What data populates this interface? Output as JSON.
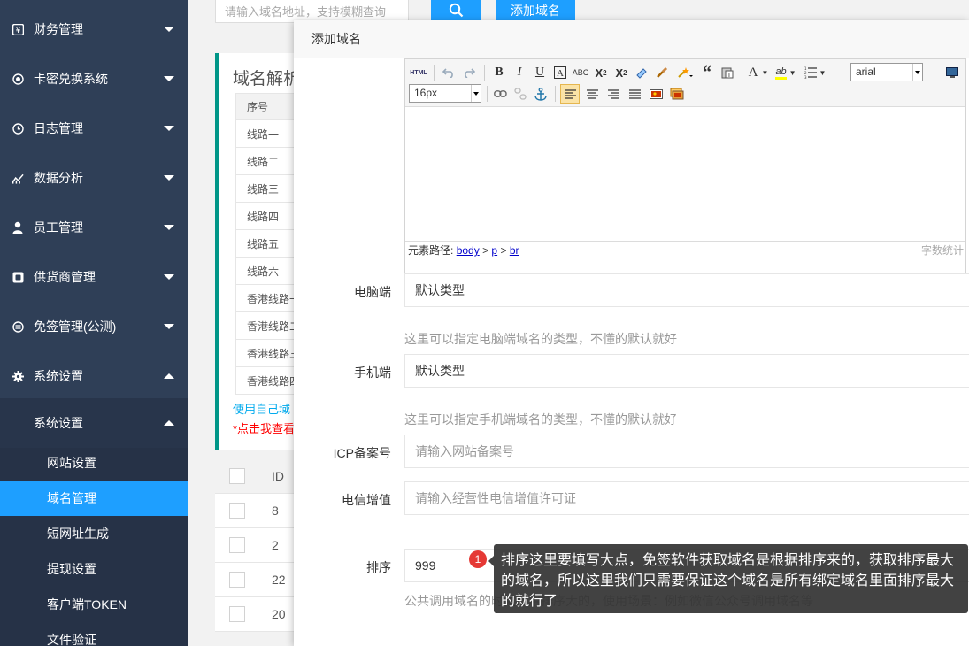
{
  "sidebar": {
    "items": [
      {
        "label": "财务管理",
        "icon": "wallet-icon"
      },
      {
        "label": "卡密兑换系统",
        "icon": "target-icon"
      },
      {
        "label": "日志管理",
        "icon": "clock-icon"
      },
      {
        "label": "数据分析",
        "icon": "chart-icon"
      },
      {
        "label": "员工管理",
        "icon": "person-icon"
      },
      {
        "label": "供货商管理",
        "icon": "box-icon"
      },
      {
        "label": "免签管理(公测)",
        "icon": "exchange-icon"
      },
      {
        "label": "系统设置",
        "icon": "gear-icon"
      }
    ],
    "submenu_title": "系统设置",
    "sub_items": [
      "网站设置",
      "域名管理",
      "短网址生成",
      "提现设置",
      "客户端TOKEN",
      "文件验证"
    ],
    "active_sub": "域名管理"
  },
  "background": {
    "search_placeholder": "请输入域名地址，支持模糊查询",
    "add_button": "添加域名",
    "panel_title": "域名解析",
    "table_header": "序号",
    "routes": [
      "线路一",
      "线路二",
      "线路三",
      "线路四",
      "线路五",
      "线路六",
      "香港线路一",
      "香港线路二",
      "香港线路三",
      "香港线路四"
    ],
    "link_text": "使用自己域",
    "red_text": "*点击我查看",
    "list_header_id": "ID",
    "list_ids": [
      "8",
      "2",
      "22",
      "20"
    ]
  },
  "modal": {
    "title": "添加域名",
    "editor": {
      "font_family": "arial",
      "font_size": "16px",
      "path_label": "元素路径:",
      "path_body": "body",
      "path_p": "p",
      "path_br": "br",
      "sep": ">",
      "word_count": "字数统计"
    },
    "form": {
      "pc_label": "电脑端",
      "pc_value": "默认类型",
      "pc_hint": "这里可以指定电脑端域名的类型，不懂的默认就好",
      "mobile_label": "手机端",
      "mobile_value": "默认类型",
      "mobile_hint": "这里可以指定手机端域名的类型，不懂的默认就好",
      "icp_label": "ICP备案号",
      "icp_placeholder": "请输入网站备案号",
      "telecom_label": "电信增值",
      "telecom_placeholder": "请输入经营性电信增值许可证",
      "sort_label": "排序",
      "sort_value": "999",
      "sort_hint": "公共调用域名的时候调用排序大的，使用场景：例如微信公众号调用域名等"
    }
  },
  "tooltip": {
    "badge": "1",
    "text": "排序这里要填写大点，免签软件获取域名是根据排序来的，获取排序最大的域名，所以这里我们只需要保证这个域名是所有绑定域名里面排序最大的就行了"
  }
}
